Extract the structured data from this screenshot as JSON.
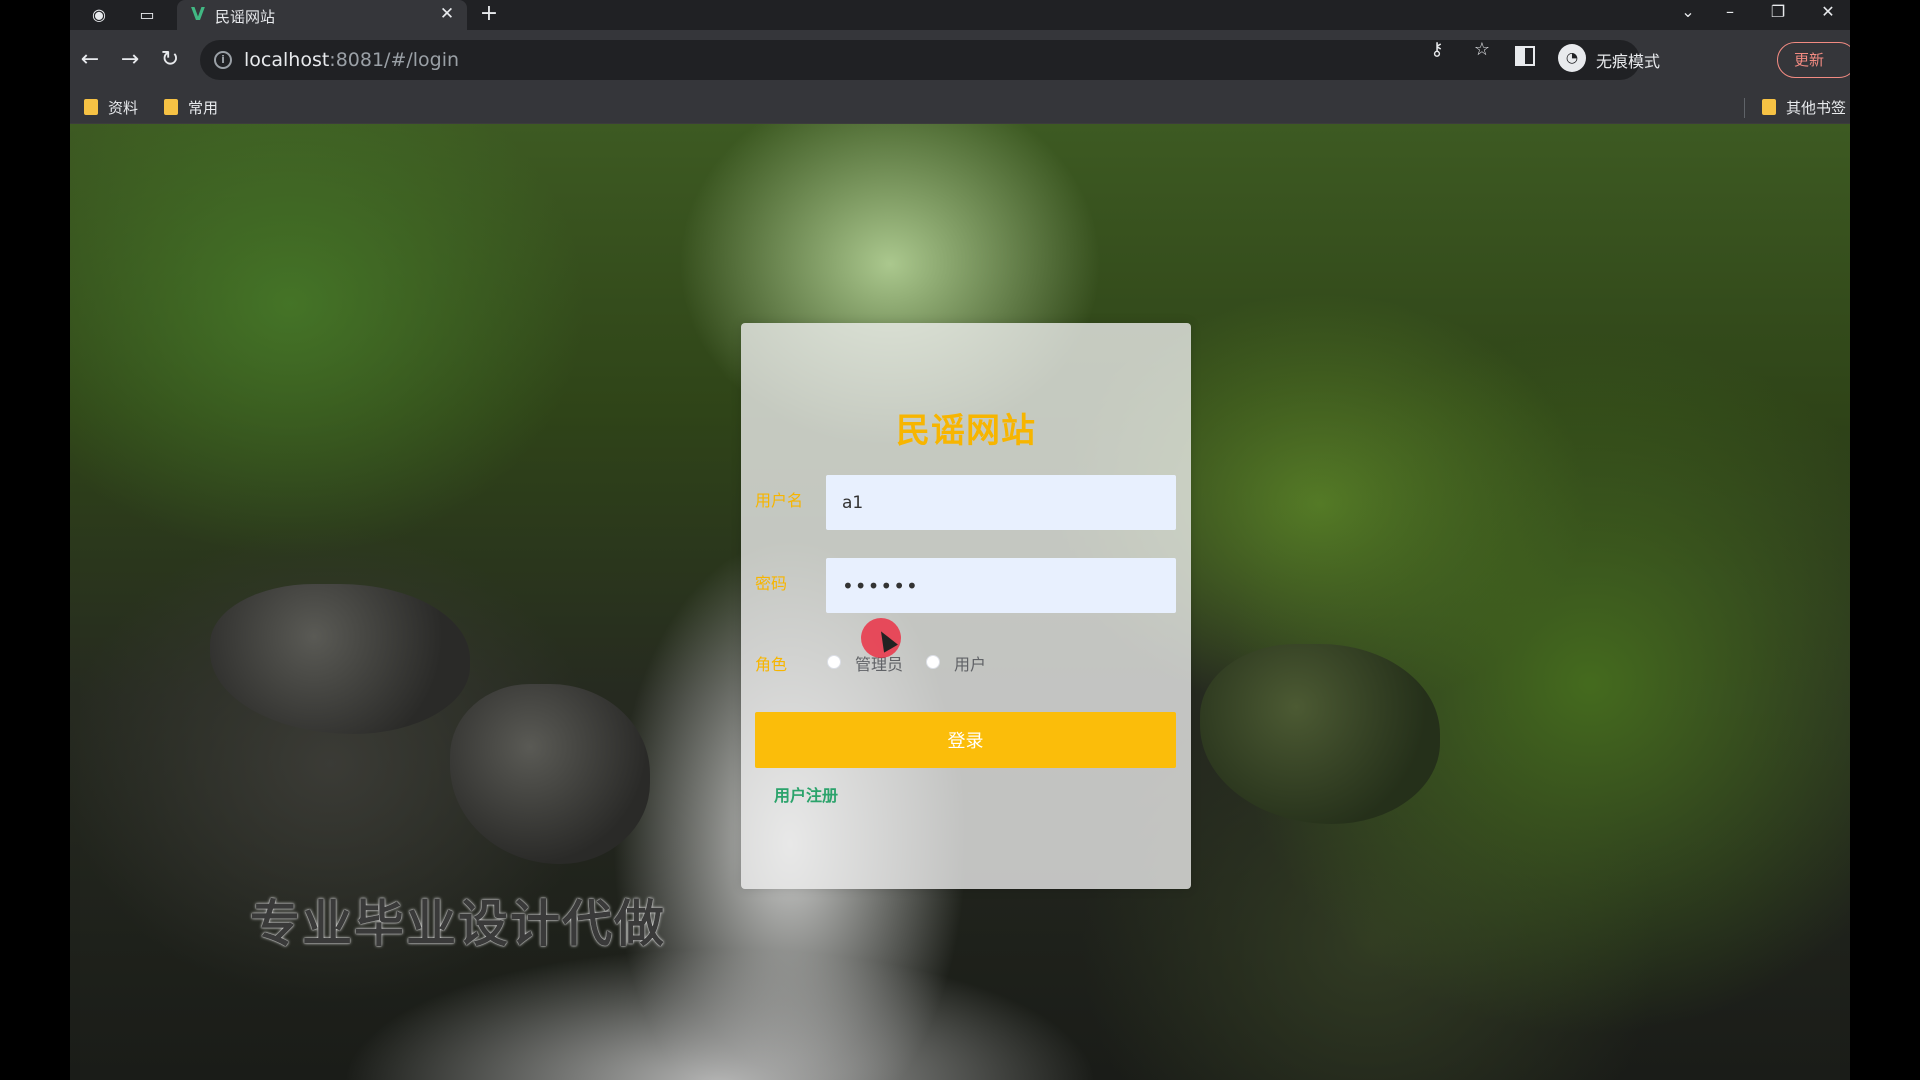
{
  "browser": {
    "tab_title": "民谣网站",
    "tab_favicon": "V",
    "url_host": "localhost",
    "url_rest": ":8081/#/login",
    "incognito_label": "无痕模式",
    "update_label": "更新",
    "bookmarks": [
      "资料",
      "常用"
    ],
    "other_bookmarks": "其他书签"
  },
  "login": {
    "title": "民谣网站",
    "username_label": "用户名",
    "username_value": "a1",
    "password_label": "密码",
    "password_value": "123456",
    "role_label": "角色",
    "role_options": [
      "管理员",
      "用户"
    ],
    "login_button": "登录",
    "register_link": "用户注册"
  },
  "overlay": {
    "watermark": "专业毕业设计代做"
  },
  "colors": {
    "accent": "#fbbd0a",
    "title": "#f7b500",
    "link": "#2ba36b"
  }
}
